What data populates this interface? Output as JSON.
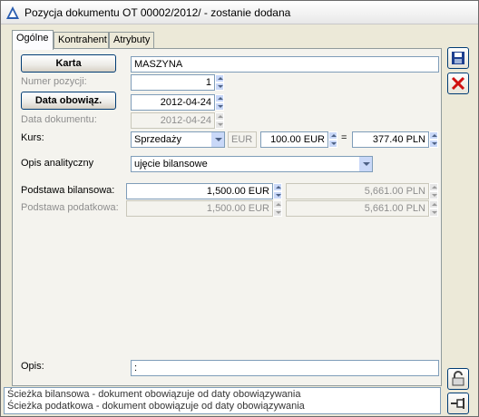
{
  "window": {
    "title": "Pozycja dokumentu OT  00002/2012/ - zostanie dodana"
  },
  "tabs": [
    {
      "label": "Ogólne",
      "active": true
    },
    {
      "label": "Kontrahent",
      "active": false
    },
    {
      "label": "Atrybuty",
      "active": false
    }
  ],
  "form": {
    "karta_button": "Karta",
    "karta_value": "MASZYNA",
    "numer_pozycji_label": "Numer pozycji:",
    "numer_pozycji_value": "1",
    "data_obowiaz_button": "Data obowiąz.",
    "data_obowiaz_value": "2012-04-24",
    "data_dokumentu_label": "Data dokumentu:",
    "data_dokumentu_value": "2012-04-24",
    "kurs_label": "Kurs:",
    "kurs_type": "Sprzedaży",
    "kurs_currency": "EUR",
    "kurs_amount": "100.00 EUR",
    "kurs_equals": "=",
    "kurs_result": "377.40 PLN",
    "opis_analityczny_label": "Opis analityczny",
    "opis_analityczny_value": "ujęcie bilansowe",
    "podstawa_bilansowa_label": "Podstawa bilansowa:",
    "podstawa_bilansowa_eur": "1,500.00 EUR",
    "podstawa_bilansowa_pln": "5,661.00 PLN",
    "podstawa_podatkowa_label": "Podstawa podatkowa:",
    "podstawa_podatkowa_eur": "1,500.00 EUR",
    "podstawa_podatkowa_pln": "5,661.00 PLN",
    "opis_label": "Opis:",
    "opis_value": ":"
  },
  "status": {
    "line1": "Ścieżka bilansowa - dokument obowiązuje od daty obowiązywania",
    "line2": "Ścieżka podatkowa - dokument obowiązuje od daty obowiązywania"
  },
  "icons": {
    "save": "save-icon",
    "delete": "delete-x-icon",
    "lock": "lock-icon",
    "pin": "pin-icon"
  }
}
